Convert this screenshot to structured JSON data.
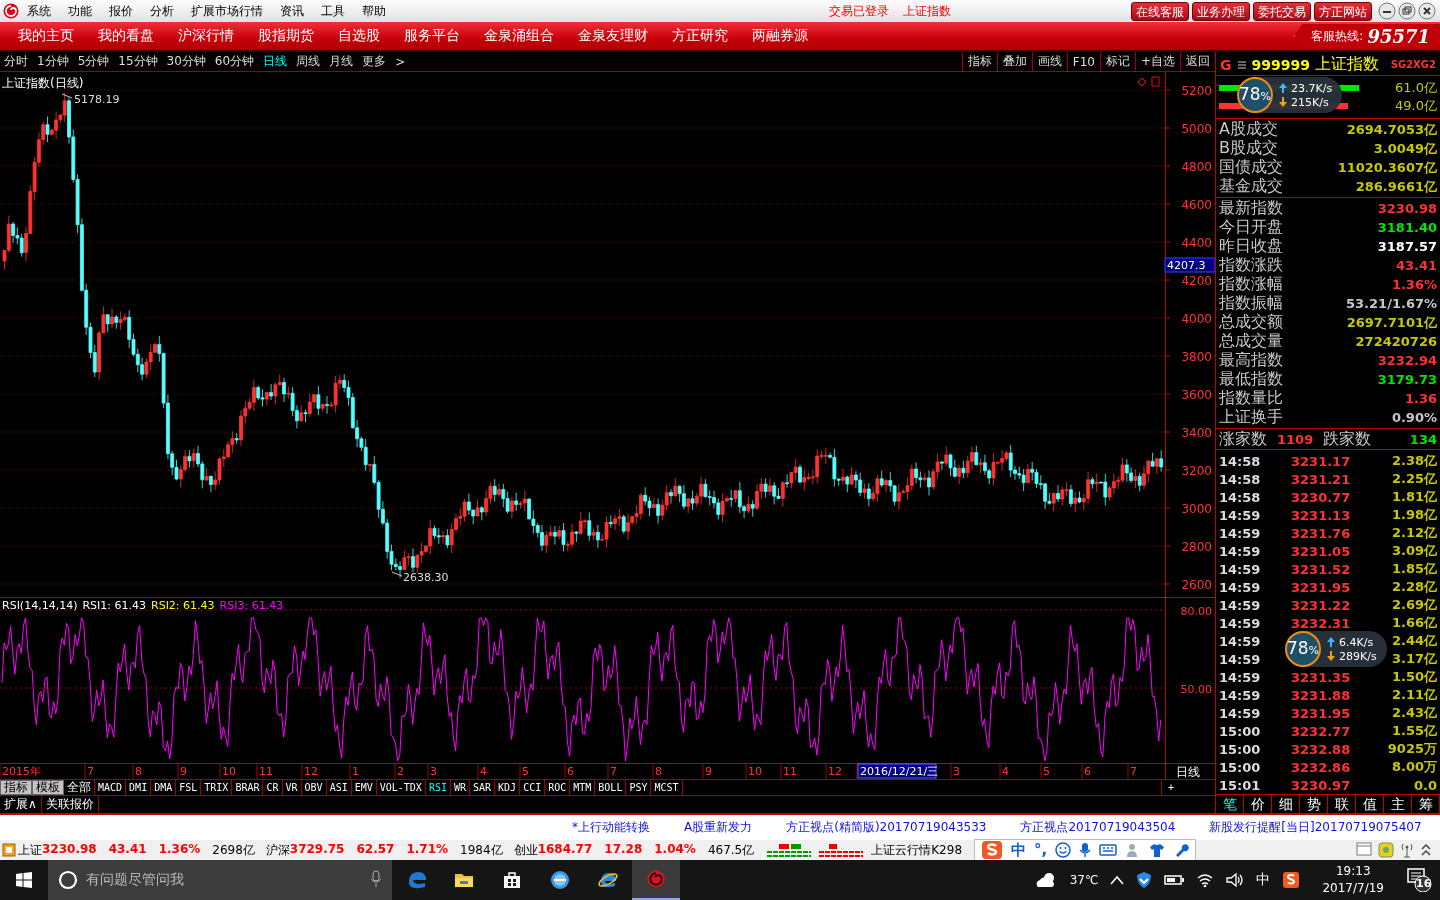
{
  "titlebar": {
    "menus": [
      "系统",
      "功能",
      "报价",
      "分析",
      "扩展市场行情",
      "资讯",
      "工具",
      "帮助"
    ],
    "status": [
      "交易已登录",
      "上证指数"
    ],
    "buttons": [
      "在线客服",
      "业务办理",
      "委托交易",
      "方正网站"
    ]
  },
  "nav": {
    "items": [
      "我的主页",
      "我的看盘",
      "沪深行情",
      "股指期货",
      "自选股",
      "服务平台",
      "金泉涌组合",
      "金泉友理财",
      "方正研究",
      "两融券源"
    ],
    "hotline_label": "客服热线:",
    "hotline": "95571"
  },
  "toolbar": {
    "periods": [
      {
        "label": "分时",
        "selected": false
      },
      {
        "label": "1分钟",
        "selected": false
      },
      {
        "label": "5分钟",
        "selected": false
      },
      {
        "label": "15分钟",
        "selected": false
      },
      {
        "label": "30分钟",
        "selected": false
      },
      {
        "label": "60分钟",
        "selected": false
      },
      {
        "label": "日线",
        "selected": true
      },
      {
        "label": "周线",
        "selected": false
      },
      {
        "label": "月线",
        "selected": false
      },
      {
        "label": "更多",
        "selected": false
      }
    ],
    "more_arrow": ">",
    "tools": [
      "指标",
      "叠加",
      "画线",
      "F10",
      "标记",
      "+自选",
      "返回"
    ]
  },
  "chart": {
    "title": "上证指数(日线)",
    "y_labels": [
      "5200",
      "5000",
      "4800",
      "4600",
      "4400",
      "4200",
      "4000",
      "3800",
      "3600",
      "3400",
      "3200",
      "3000",
      "2800",
      "2600"
    ],
    "high_label": "5178.19",
    "low_label": "2638.30",
    "cursor_value": "4207.3",
    "rsi": {
      "legend": [
        {
          "text": "RSI(14,14,14)",
          "color": "#ffffff"
        },
        {
          "text": "RSI1: 61.43",
          "color": "#ffffff"
        },
        {
          "text": "RSI2: 61.43",
          "color": "#ffff00"
        },
        {
          "text": "RSI3: 61.43",
          "color": "#ff00ff"
        }
      ],
      "y_labels": [
        "80.00",
        "50.00"
      ]
    },
    "date_labels": [
      {
        "text": "2015年",
        "selected": false
      },
      {
        "text": "7",
        "selected": false
      },
      {
        "text": "8",
        "selected": false
      },
      {
        "text": "9",
        "selected": false
      },
      {
        "text": "10",
        "selected": false
      },
      {
        "text": "11",
        "selected": false
      },
      {
        "text": "12",
        "selected": false
      },
      {
        "text": "1",
        "selected": false
      },
      {
        "text": "2",
        "selected": false
      },
      {
        "text": "3",
        "selected": false
      },
      {
        "text": "4",
        "selected": false
      },
      {
        "text": "5",
        "selected": false
      },
      {
        "text": "6",
        "selected": false
      },
      {
        "text": "7",
        "selected": false
      },
      {
        "text": "8",
        "selected": false
      },
      {
        "text": "9",
        "selected": false
      },
      {
        "text": "10",
        "selected": false
      },
      {
        "text": "11",
        "selected": false
      },
      {
        "text": "12",
        "selected": false
      },
      {
        "text": "2016/12/21/三",
        "selected": true
      },
      {
        "text": "3",
        "selected": false
      },
      {
        "text": "4",
        "selected": false
      },
      {
        "text": "5",
        "selected": false
      },
      {
        "text": "6",
        "selected": false
      },
      {
        "text": "7",
        "selected": false
      }
    ],
    "period_label": "日线",
    "add_label": "+",
    "indicator_tabs": [
      {
        "label": "指标",
        "kind": "mode",
        "selected": false
      },
      {
        "label": "模板",
        "kind": "mode",
        "selected": false
      },
      {
        "label": "全部",
        "kind": "indicator",
        "selected": false
      },
      {
        "label": "MACD",
        "kind": "indicator",
        "selected": false
      },
      {
        "label": "DMI",
        "kind": "indicator",
        "selected": false
      },
      {
        "label": "DMA",
        "kind": "indicator",
        "selected": false
      },
      {
        "label": "FSL",
        "kind": "indicator",
        "selected": false
      },
      {
        "label": "TRIX",
        "kind": "indicator",
        "selected": false
      },
      {
        "label": "BRAR",
        "kind": "indicator",
        "selected": false
      },
      {
        "label": "CR",
        "kind": "indicator",
        "selected": false
      },
      {
        "label": "VR",
        "kind": "indicator",
        "selected": false
      },
      {
        "label": "OBV",
        "kind": "indicator",
        "selected": false
      },
      {
        "label": "ASI",
        "kind": "indicator",
        "selected": false
      },
      {
        "label": "EMV",
        "kind": "indicator",
        "selected": false
      },
      {
        "label": "VOL-TDX",
        "kind": "indicator",
        "selected": false
      },
      {
        "label": "RSI",
        "kind": "indicator",
        "selected": true
      },
      {
        "label": "WR",
        "kind": "indicator",
        "selected": false
      },
      {
        "label": "SAR",
        "kind": "indicator",
        "selected": false
      },
      {
        "label": "KDJ",
        "kind": "indicator",
        "selected": false
      },
      {
        "label": "CCI",
        "kind": "indicator",
        "selected": false
      },
      {
        "label": "ROC",
        "kind": "indicator",
        "selected": false
      },
      {
        "label": "MTM",
        "kind": "indicator",
        "selected": false
      },
      {
        "label": "BOLL",
        "kind": "indicator",
        "selected": false
      },
      {
        "label": "PSY",
        "kind": "indicator",
        "selected": false
      },
      {
        "label": "MCST",
        "kind": "indicator",
        "selected": false
      }
    ],
    "bottom_tabs": [
      "扩展∧",
      "关联报价"
    ]
  },
  "quote": {
    "header": {
      "flag": "G",
      "code": "999999",
      "name": "上证指数",
      "badge": "SG2XG2"
    },
    "flow": [
      {
        "value": "61.0亿",
        "level": 0.93,
        "color": "#00e600"
      },
      {
        "value": "49.0亿",
        "level": 0.86,
        "color": "#ff3232"
      }
    ],
    "turnover": [
      {
        "label": "A股成交",
        "value": "2694.7053亿"
      },
      {
        "label": "B股成交",
        "value": "3.0049亿"
      },
      {
        "label": "国债成交",
        "value": "11020.3607亿"
      },
      {
        "label": "基金成交",
        "value": "286.9661亿"
      }
    ],
    "stats": [
      {
        "label": "最新指数",
        "value": "3230.98",
        "color": "#ff3232"
      },
      {
        "label": "今日开盘",
        "value": "3181.40",
        "color": "#00e600"
      },
      {
        "label": "昨日收盘",
        "value": "3187.57",
        "color": "#ffffff"
      },
      {
        "label": "指数涨跌",
        "value": "43.41",
        "color": "#ff3232"
      },
      {
        "label": "指数涨幅",
        "value": "1.36%",
        "color": "#ff3232"
      },
      {
        "label": "指数振幅",
        "value": "53.21/1.67%",
        "color": "#c8c8c8"
      },
      {
        "label": "总成交额",
        "value": "2697.7101亿",
        "color": "#c8c800"
      },
      {
        "label": "总成交量",
        "value": "272420726",
        "color": "#c8c800"
      },
      {
        "label": "最高指数",
        "value": "3232.94",
        "color": "#ff3232"
      },
      {
        "label": "最低指数",
        "value": "3179.73",
        "color": "#00e600"
      },
      {
        "label": "指数量比",
        "value": "1.36",
        "color": "#ff3232"
      },
      {
        "label": "上证换手",
        "value": "0.90%",
        "color": "#c8c8c8"
      }
    ],
    "breadth": {
      "up_label": "涨家数",
      "up": "1109",
      "down_label": "跌家数",
      "down": "134"
    },
    "ticks": [
      {
        "time": "14:58",
        "price": "3231.17",
        "volume": "2.38亿"
      },
      {
        "time": "14:58",
        "price": "3231.21",
        "volume": "2.25亿"
      },
      {
        "time": "14:58",
        "price": "3230.77",
        "volume": "1.81亿"
      },
      {
        "time": "14:59",
        "price": "3231.13",
        "volume": "1.98亿"
      },
      {
        "time": "14:59",
        "price": "3231.76",
        "volume": "2.12亿"
      },
      {
        "time": "14:59",
        "price": "3231.05",
        "volume": "3.09亿"
      },
      {
        "time": "14:59",
        "price": "3231.52",
        "volume": "1.85亿"
      },
      {
        "time": "14:59",
        "price": "3231.95",
        "volume": "2.28亿"
      },
      {
        "time": "14:59",
        "price": "3231.22",
        "volume": "2.69亿"
      },
      {
        "time": "14:59",
        "price": "3232.31",
        "volume": "1.66亿"
      },
      {
        "time": "14:59",
        "volume": "2.44亿"
      },
      {
        "time": "14:59",
        "volume": "3.17亿"
      },
      {
        "time": "14:59",
        "price": "3231.35",
        "volume": "1.50亿"
      },
      {
        "time": "14:59",
        "price": "3231.88",
        "volume": "2.11亿"
      },
      {
        "time": "14:59",
        "price": "3231.95",
        "volume": "2.43亿"
      },
      {
        "time": "15:00",
        "price": "3232.77",
        "volume": "1.55亿"
      },
      {
        "time": "15:00",
        "price": "3232.88",
        "volume": "9025万"
      },
      {
        "time": "15:00",
        "price": "3232.86",
        "volume": "8.00万"
      },
      {
        "time": "15:01",
        "price": "3230.97",
        "volume": "0.0"
      }
    ],
    "tabs": [
      {
        "label": "笔",
        "selected": true
      },
      {
        "label": "价",
        "selected": false
      },
      {
        "label": "细",
        "selected": false
      },
      {
        "label": "势",
        "selected": false
      },
      {
        "label": "联",
        "selected": false
      },
      {
        "label": "值",
        "selected": false
      },
      {
        "label": "主",
        "selected": false
      },
      {
        "label": "筹",
        "selected": false
      }
    ]
  },
  "speed_widgets": [
    {
      "percent": "78",
      "unit": "%",
      "up": "23.7K/s",
      "down": "215K/s"
    },
    {
      "percent": "78",
      "unit": "%",
      "up": "6.4K/s",
      "down": "289K/s"
    }
  ],
  "ticker": [
    "*上行动能转换",
    "A股重新发力",
    "方正视点(精简版)20170719043533",
    "方正视点20170719043504",
    "新股发行提醒[当日]20170719075407"
  ],
  "statusbar": {
    "indices": [
      {
        "name": "上证",
        "value": "3230.98",
        "change": "43.41",
        "percent": "1.36%",
        "amount": "2698亿"
      },
      {
        "name": "沪深",
        "value": "3729.75",
        "change": "62.57",
        "percent": "1.71%",
        "amount": "1984亿"
      },
      {
        "name": "创业",
        "value": "1684.77",
        "change": "17.28",
        "percent": "1.04%",
        "amount": "467.5亿"
      }
    ],
    "cloud": "上证云行情K298",
    "ime": [
      "中",
      "°,"
    ]
  },
  "taskbar": {
    "search_placeholder": "有问题尽管问我",
    "weather": "37℃",
    "ime": "中",
    "time": "19:13",
    "date": "2017/7/19",
    "notifications": "16"
  }
}
